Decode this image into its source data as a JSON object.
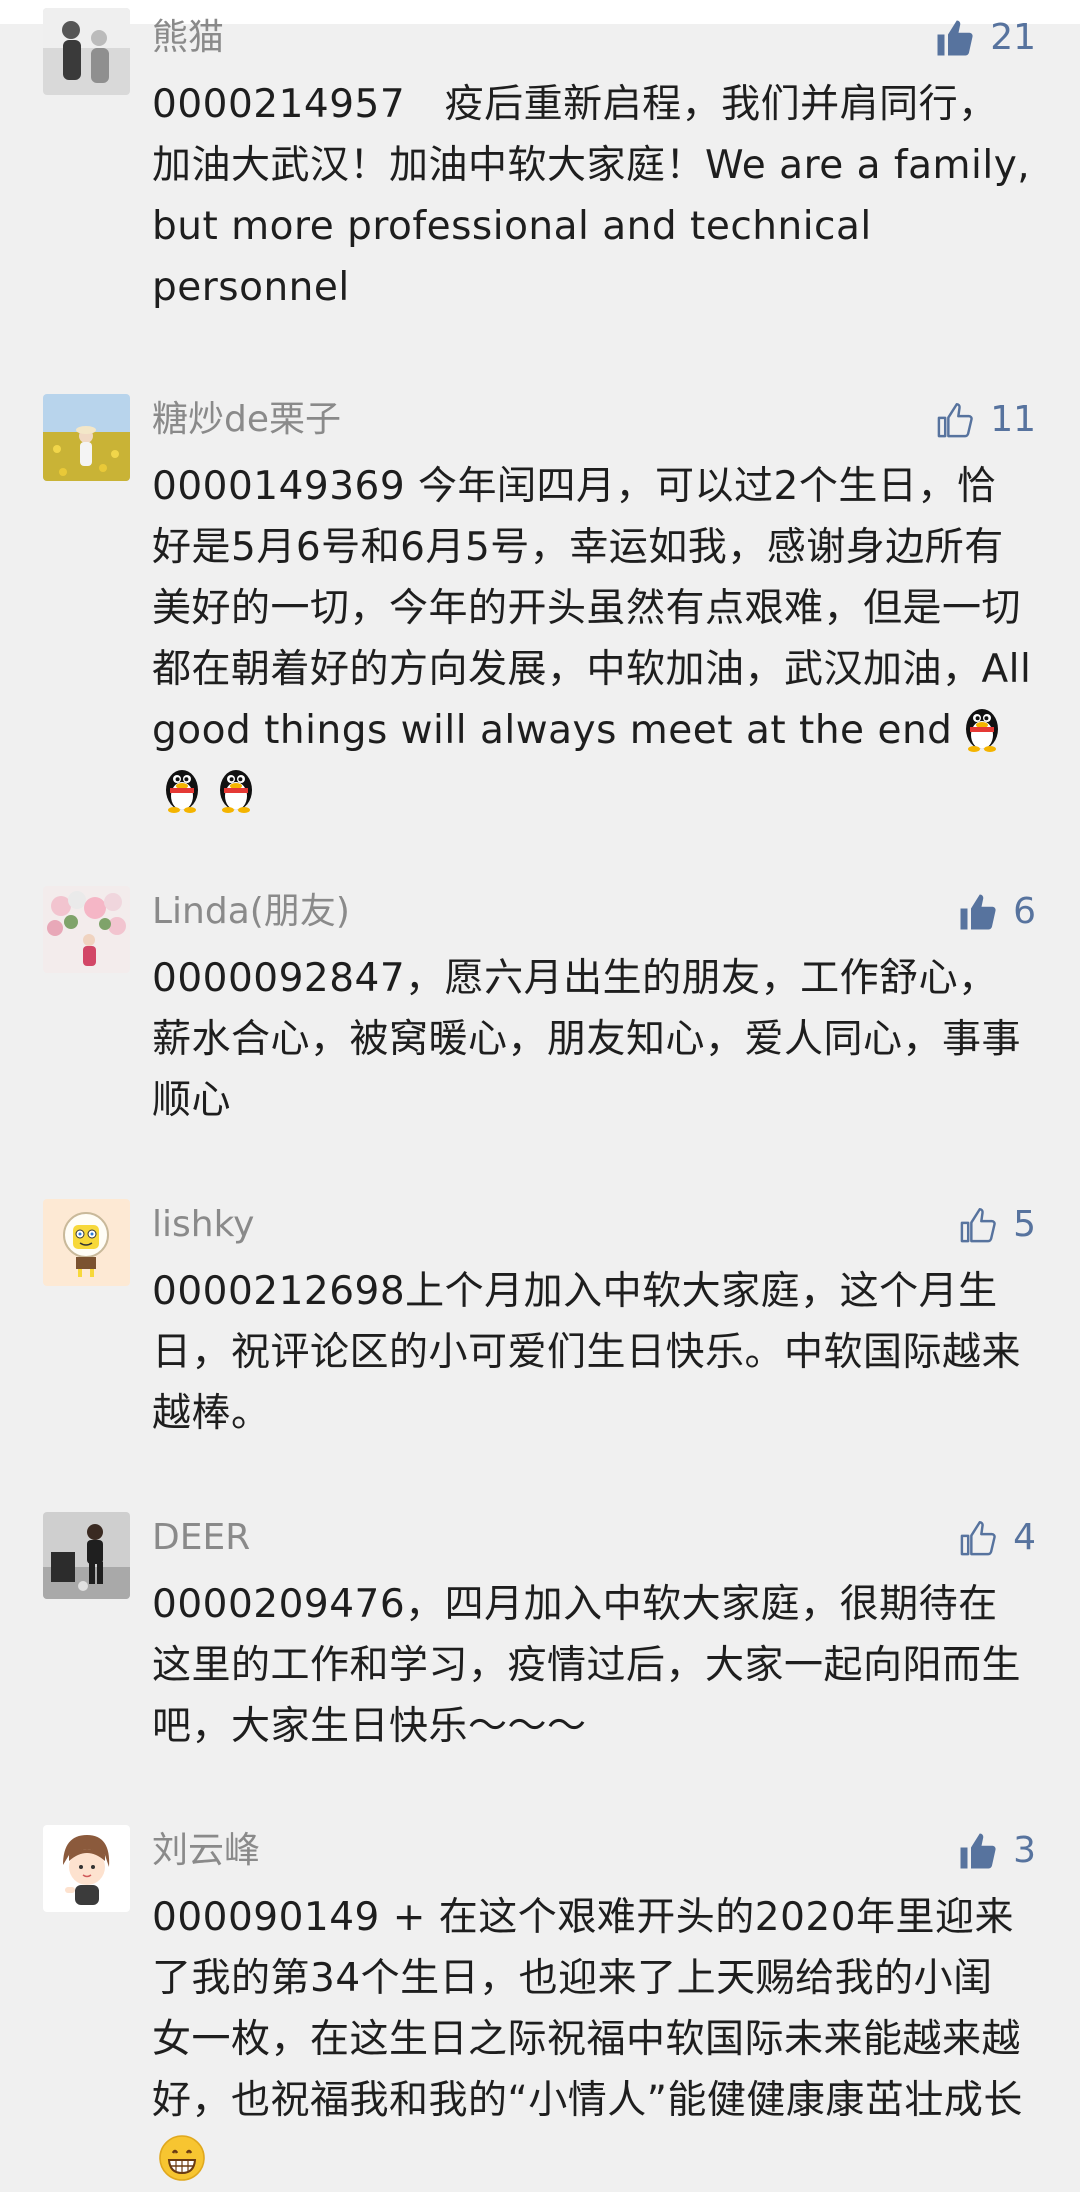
{
  "comments": [
    {
      "nickname": "熊猫",
      "likes": "21",
      "liked": true,
      "text": "0000214957　疫后重新启程，我们并肩同行，加油大武汉！加油中软大家庭！We are a family, but more professional and technical personnel",
      "avatar_icon": "avatar-photo-icon"
    },
    {
      "nickname": "糖炒de栗子",
      "likes": "11",
      "liked": false,
      "text": "0000149369 今年闰四月，可以过2个生日，恰好是5月6号和6月5号，幸运如我，感谢身边所有美好的一切，今年的开头虽然有点艰难，但是一切都在朝着好的方向发展，中软加油，武汉加油，All good things will always meet at the end",
      "avatar_icon": "avatar-photo-icon",
      "trailing_emoji": "penguin-emoji-icon"
    },
    {
      "nickname": "Linda(朋友)",
      "likes": "6",
      "liked": true,
      "text": "0000092847，愿六月出生的朋友，工作舒心，薪水合心，被窝暖心，朋友知心，爱人同心，事事顺心",
      "avatar_icon": "avatar-photo-icon"
    },
    {
      "nickname": "lishky",
      "likes": "5",
      "liked": false,
      "text": "0000212698上个月加入中软大家庭，这个月生日，祝评论区的小可爱们生日快乐。中软国际越来越棒。",
      "avatar_icon": "avatar-photo-icon"
    },
    {
      "nickname": "DEER",
      "likes": "4",
      "liked": false,
      "text": "0000209476，四月加入中软大家庭，很期待在这里的工作和学习，疫情过后，大家一起向阳而生吧，大家生日快乐～～～",
      "avatar_icon": "avatar-photo-icon"
    },
    {
      "nickname": "刘云峰",
      "likes": "3",
      "liked": true,
      "text": "000090149 + 在这个艰难开头的2020年里迎来了我的第34个生日，也迎来了上天赐给我的小闺女一枚，在这生日之际祝福中软国际未来能越来越好，也祝福我和我的“小情人”能健健康康茁壮成长",
      "avatar_icon": "avatar-illustration-icon",
      "trailing_emoji": "grin-emoji-icon"
    }
  ],
  "colors": {
    "background": "#f0f0f0",
    "nickname": "#8a8a8a",
    "text": "#1e1e1e",
    "like_accent": "#57739e"
  }
}
